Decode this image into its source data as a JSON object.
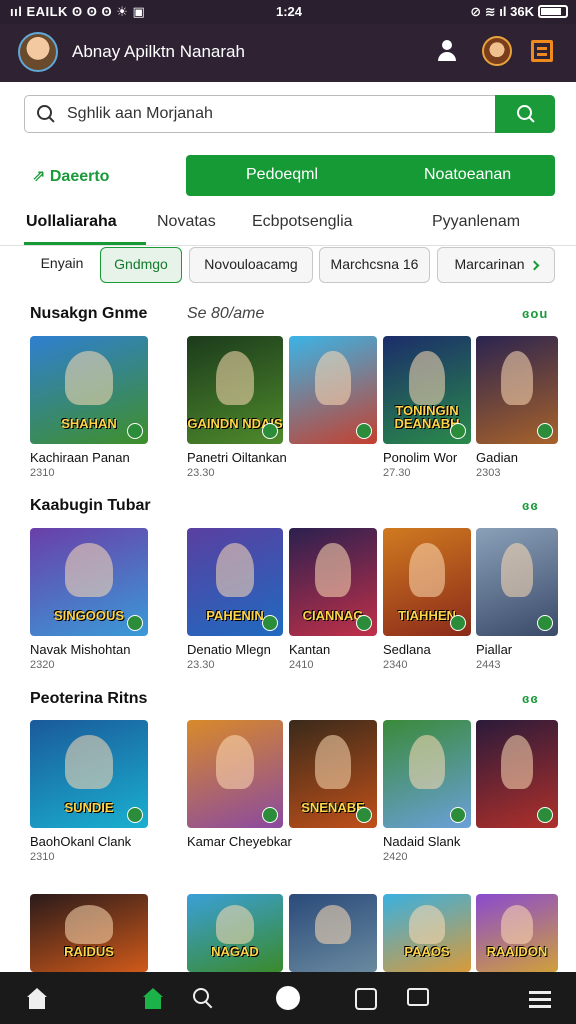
{
  "status_bar": {
    "left": "ııl EAILK ʘ ʘ ʘ ☀ ▣",
    "time": "1:24",
    "right": "⊘ ≋ ıl 36K"
  },
  "app_bar": {
    "title": "Abnay Apilktn Nanarah"
  },
  "search": {
    "placeholder": "Sghlik aan Morjanah"
  },
  "filter": {
    "discover_label": "Daeerto",
    "green_left": "Pedoeqml",
    "green_right": "Noatoeanan"
  },
  "tabs": [
    {
      "label": "Uollaliaraha"
    },
    {
      "label": "Novatas"
    },
    {
      "label": "Ecbpotsenglia"
    },
    {
      "label": "Pyyanlenam"
    }
  ],
  "chips": [
    {
      "label": "Enyain"
    },
    {
      "label": "Gndmgo"
    },
    {
      "label": "Novouloacamg"
    },
    {
      "label": "Marchcsna 16"
    },
    {
      "label": "Marcarinan"
    }
  ],
  "sections": [
    {
      "title": "Nusakgn Gnme",
      "subtitle": "Se 80/ame",
      "more": "ɞou",
      "cards": [
        {
          "name": "Kachiraan Panan",
          "size": "2310",
          "art": "SHAHAN",
          "c1": "#2f7fd1",
          "c2": "#3f8f2a"
        },
        {
          "name": "Panetri Oiltankan",
          "size": "23.30",
          "art": "GAINDN NDAIS",
          "c1": "#1c3b1c",
          "c2": "#4e8a2b"
        },
        {
          "name": "",
          "size": "",
          "art": "",
          "c1": "#3bb4e6",
          "c2": "#c4402f"
        },
        {
          "name": "Ponolim Wor",
          "size": "27.30",
          "art": "TONINGIN DEANABH",
          "c1": "#1b2d6a",
          "c2": "#2a8a4a"
        },
        {
          "name": "Gadian",
          "size": "2303",
          "art": "",
          "c1": "#2a2450",
          "c2": "#a8622a"
        }
      ]
    },
    {
      "title": "Kaabugin Tubar",
      "subtitle": "",
      "more": "ɞɞ",
      "cards": [
        {
          "name": "Navak Mishohtan",
          "size": "2320",
          "art": "SINGOOUS",
          "c1": "#6a3fa8",
          "c2": "#3a9ad8"
        },
        {
          "name": "Denatio Mlegn",
          "size": "23.30",
          "art": "PAHENIN",
          "c1": "#5a3fa0",
          "c2": "#1f6ac0"
        },
        {
          "name": "Kantan",
          "size": "2410",
          "art": "CIANNAG",
          "c1": "#2b2050",
          "c2": "#c03048"
        },
        {
          "name": "Sedlana",
          "size": "2340",
          "art": "TIAHHEN",
          "c1": "#d07a20",
          "c2": "#8a2a1a"
        },
        {
          "name": "Piallar",
          "size": "2443",
          "art": "",
          "c1": "#8aa0b8",
          "c2": "#3a4a6a"
        }
      ]
    },
    {
      "title": "Peoterina Ritns",
      "subtitle": "",
      "more": "ɞɞ",
      "cards": [
        {
          "name": "BaohOkanl Clank",
          "size": "2310",
          "art": "SUNDIE",
          "c1": "#1a5a9a",
          "c2": "#1ab0d0"
        },
        {
          "name": "Kamar Cheyebkar",
          "size": "",
          "art": "",
          "c1": "#d88a2a",
          "c2": "#8a4aa0"
        },
        {
          "name": "",
          "size": "",
          "art": "SNENABE",
          "c1": "#3a2a1a",
          "c2": "#c0501a"
        },
        {
          "name": "Nadaid Slank",
          "size": "2420",
          "art": "",
          "c1": "#3a8a3a",
          "c2": "#6aa0d8"
        },
        {
          "name": "",
          "size": "",
          "art": "",
          "c1": "#2a1a3a",
          "c2": "#b0302a"
        }
      ]
    },
    {
      "title": "",
      "subtitle": "",
      "more": "",
      "cards": [
        {
          "name": "",
          "size": "",
          "art": "RAIDUS",
          "c1": "#2a1a1a",
          "c2": "#d05a1a"
        },
        {
          "name": "",
          "size": "",
          "art": "NAGAD",
          "c1": "#3aa0d8",
          "c2": "#3a8a2a"
        },
        {
          "name": "",
          "size": "",
          "art": "",
          "c1": "#2a4a7a",
          "c2": "#6a8aa0"
        },
        {
          "name": "",
          "size": "",
          "art": "PAAOS",
          "c1": "#3ab0e0",
          "c2": "#d89a3a"
        },
        {
          "name": "",
          "size": "",
          "art": "RAAIDON",
          "c1": "#8a4ad0",
          "c2": "#d0a03a"
        }
      ]
    }
  ]
}
